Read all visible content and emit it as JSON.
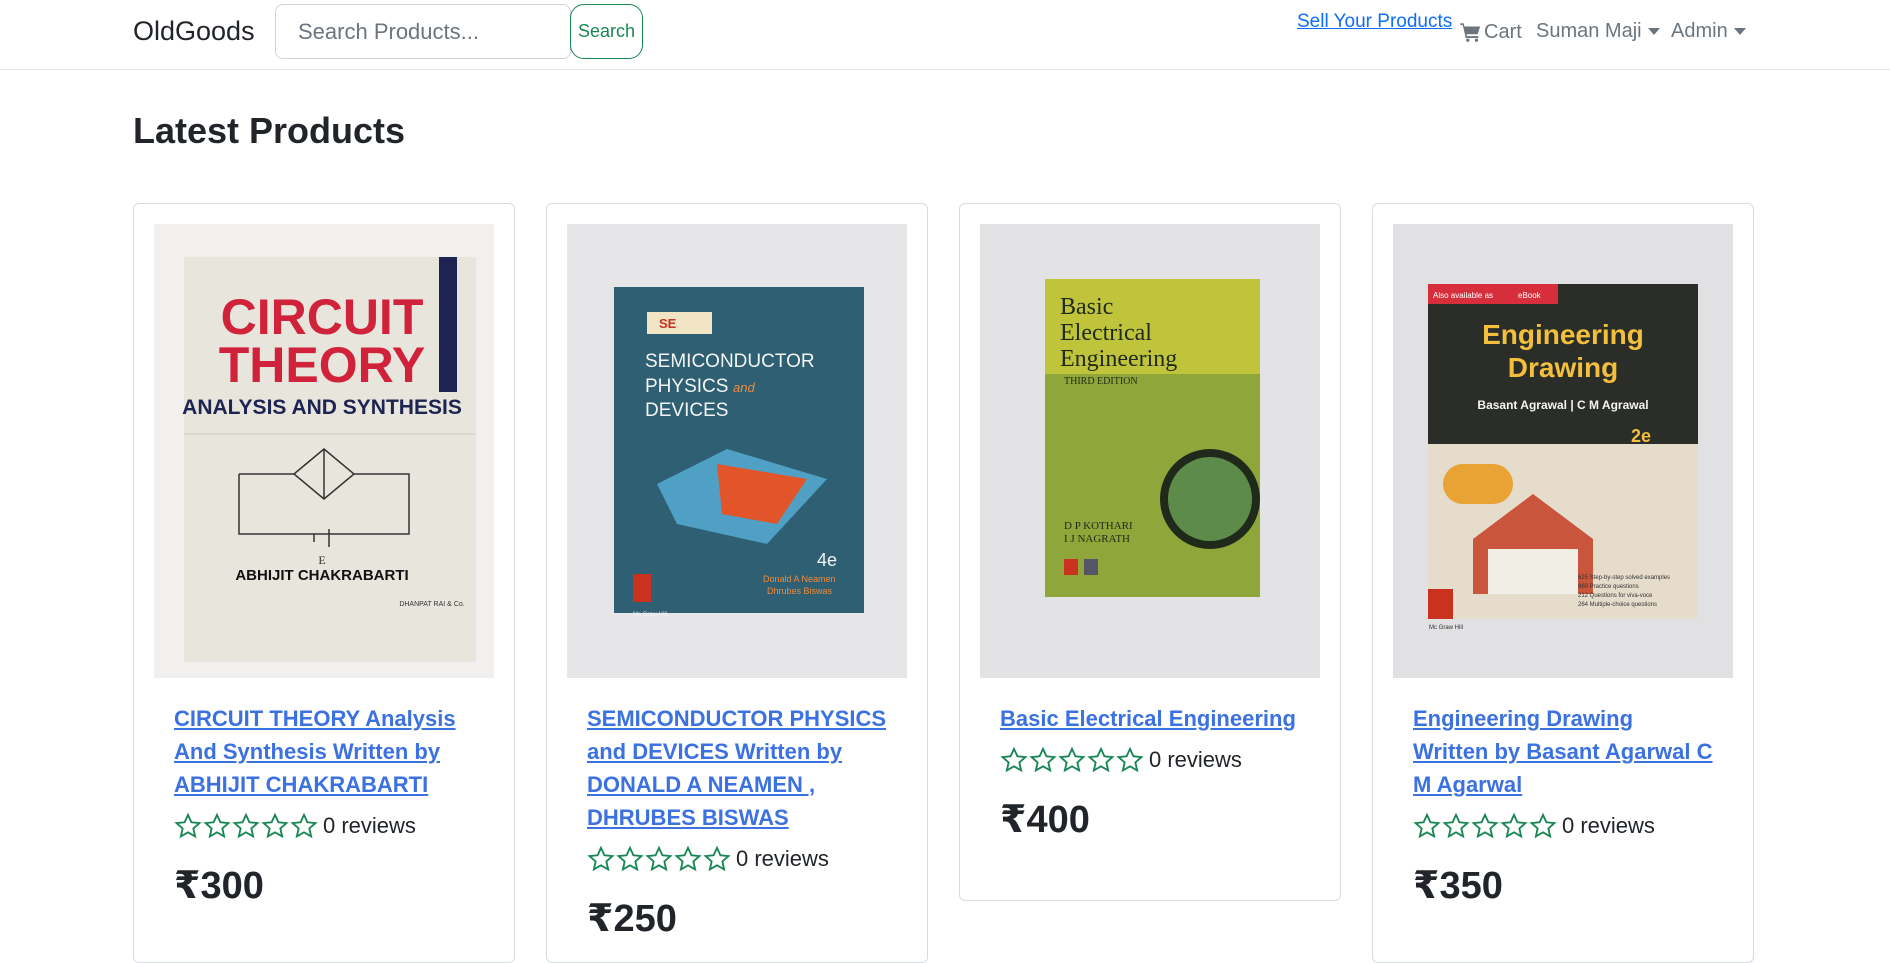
{
  "nav": {
    "brand": "OldGoods",
    "search_placeholder": "Search Products...",
    "search_label": "Search",
    "sell_link": "Sell Your Products",
    "cart_label": "Cart",
    "user_menu": "Suman Maji",
    "admin_menu": "Admin"
  },
  "main": {
    "title": "Latest Products",
    "products": [
      {
        "name": "CIRCUIT THEORY Analysis And Synthesis Written by ABHIJIT CHAKRABARTI",
        "reviews": "0 reviews",
        "rating": 0,
        "price": "₹300",
        "cover": {
          "bg": "#e8e6df",
          "title_lines": [
            "CIRCUIT",
            "THEORY"
          ],
          "subtitle": "ANALYSIS AND SYNTHESIS",
          "author": "ABHIJIT CHAKRABARTI",
          "publisher": "DHANPAT RAI & Co.",
          "E": "E"
        }
      },
      {
        "name": "SEMICONDUCTOR PHYSICS and DEVICES Written by DONALD A NEAMEN , DHRUBES BISWAS",
        "reviews": "0 reviews",
        "rating": 0,
        "price": "₹250",
        "cover": {
          "bg": "#e4e3e6",
          "badge": "SE",
          "title_lines": [
            "SEMICONDUCTOR",
            "PHYSICS",
            "DEVICES"
          ],
          "and_word": "and",
          "edition": "4e",
          "authors": [
            "Donald A Neamen",
            "Dhrubes Biswas"
          ],
          "logo": "Mc Graw Hill"
        }
      },
      {
        "name": "Basic Electrical Engineering",
        "reviews": "0 reviews",
        "rating": 0,
        "price": "₹400",
        "cover": {
          "bg": "#e2e1e3",
          "title_lines": [
            "Basic",
            "Electrical",
            "Engineering"
          ],
          "edition": "THIRD EDITION",
          "authors": [
            "D P KOTHARI",
            "I J NAGRATH"
          ]
        }
      },
      {
        "name": "Engineering Drawing Written by Basant Agarwal C M Agarwal",
        "reviews": "0 reviews",
        "rating": 0,
        "price": "₹350",
        "cover": {
          "bg": "#dfdee0",
          "title_lines": [
            "Engineering",
            "Drawing"
          ],
          "authors": "Basant Agrawal  |  C M Agrawal",
          "edition": "2e",
          "top_label": "Also available as",
          "ebook": "eBook",
          "logo": "Mc Graw Hill",
          "bullets": [
            "625 Step-by-step solved examples",
            "860 Practice questions",
            "212 Questions for viva-voce",
            "264 Multiple-choice questions"
          ]
        }
      }
    ]
  },
  "colors": {
    "link": "#3b71e0",
    "success": "#198754",
    "star": "#198754",
    "muted": "#6c757d"
  }
}
